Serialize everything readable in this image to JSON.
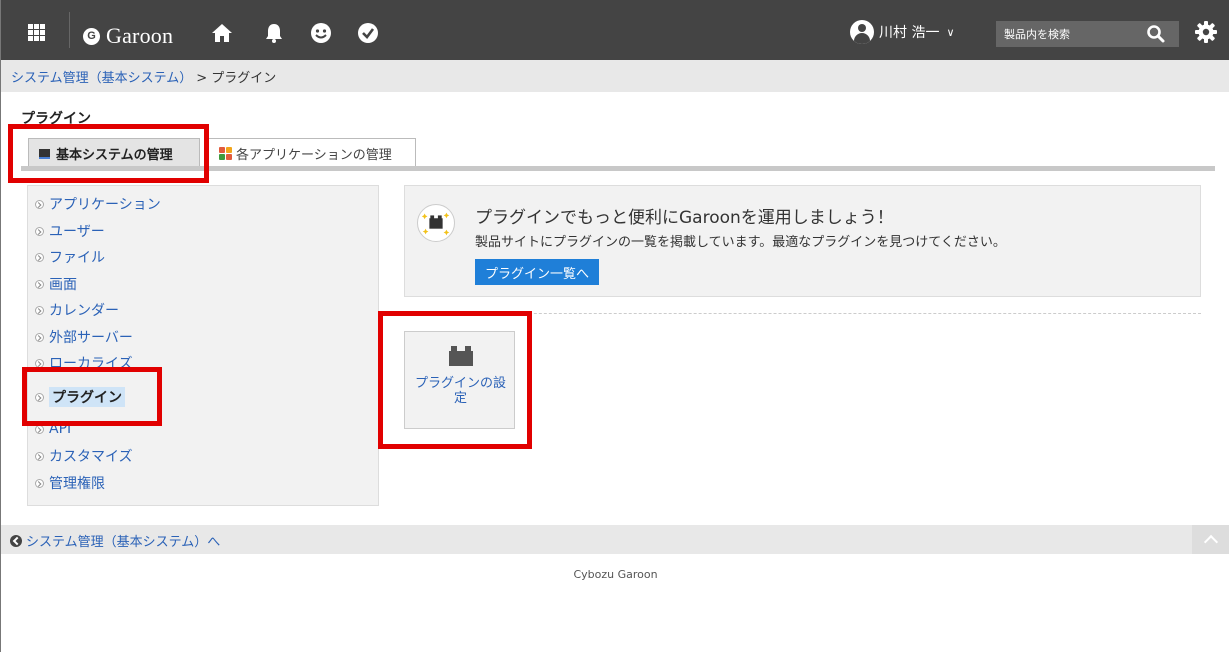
{
  "header": {
    "app_name": "Garoon",
    "logo_letter": "G",
    "user_name": "川村 浩一",
    "user_caret": "∨",
    "search_placeholder": "製品内を検索",
    "icons": [
      "grid-icon",
      "home-icon",
      "bell-icon",
      "smile-icon",
      "check-circle-icon",
      "search-icon",
      "gear-icon"
    ],
    "bg_color": "#444444"
  },
  "breadcrumb": {
    "parent": "システム管理（基本システム）",
    "separator": ">",
    "current": "プラグイン"
  },
  "page_title": "プラグイン",
  "tabs": [
    {
      "label": "基本システムの管理",
      "active": true
    },
    {
      "label": "各アプリケーションの管理",
      "active": false
    }
  ],
  "menu": [
    {
      "label": "アプリケーション"
    },
    {
      "label": "ユーザー"
    },
    {
      "label": "ファイル"
    },
    {
      "label": "画面"
    },
    {
      "label": "カレンダー"
    },
    {
      "label": "外部サーバー"
    },
    {
      "label": "ローカライズ"
    },
    {
      "label": "プラグイン",
      "current": true
    },
    {
      "label": "API"
    },
    {
      "label": "カスタマイズ"
    },
    {
      "label": "管理権限"
    }
  ],
  "promo": {
    "title": "プラグインでもっと便利にGaroonを運用しましょう！",
    "description": "製品サイトにプラグインの一覧を掲載しています。最適なプラグインを見つけてください。",
    "button": "プラグイン一覧へ"
  },
  "plugin_tile": {
    "line1": "プラグインの設",
    "line2": "定"
  },
  "footer": {
    "back_link": "システム管理（基本システム）へ",
    "copyright": "Cybozu Garoon"
  },
  "colors": {
    "link": "#2b62b7",
    "accent_button": "#1f7fd8",
    "annotation": "#e10000"
  }
}
